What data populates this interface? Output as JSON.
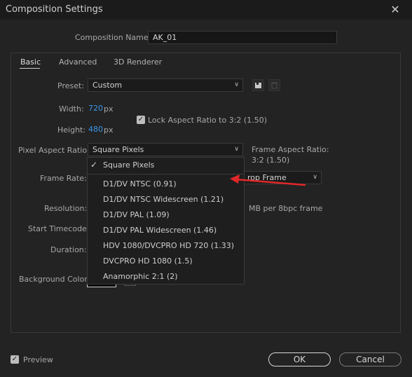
{
  "window": {
    "title": "Composition Settings",
    "close_glyph": "✕"
  },
  "comp_name": {
    "label": "Composition Name:",
    "value": "AK_01"
  },
  "tabs": [
    {
      "label": "Basic",
      "active": true
    },
    {
      "label": "Advanced",
      "active": false
    },
    {
      "label": "3D Renderer",
      "active": false
    }
  ],
  "preset": {
    "label": "Preset:",
    "value": "Custom"
  },
  "width": {
    "label": "Width:",
    "value": "720",
    "unit": "px"
  },
  "height": {
    "label": "Height:",
    "value": "480",
    "unit": "px"
  },
  "lock_aspect": {
    "label": "Lock Aspect Ratio to 3:2 (1.50)",
    "checked": true
  },
  "pixel_aspect": {
    "label": "Pixel Aspect Ratio:",
    "value": "Square Pixels"
  },
  "frame_aspect": {
    "label": "Frame Aspect Ratio:",
    "value": "3:2 (1.50)"
  },
  "frame_rate": {
    "label": "Frame Rate:",
    "drop_frame_fragment": "rop Frame"
  },
  "resolution": {
    "label": "Resolution:",
    "info_fragment": "MB per 8bpc frame"
  },
  "start_timecode": {
    "label": "Start Timecode:"
  },
  "duration": {
    "label": "Duration:"
  },
  "background_color": {
    "label": "Background Color:"
  },
  "dropdown": {
    "selected": "Square Pixels",
    "options": [
      "D1/DV NTSC (0.91)",
      "D1/DV NTSC Widescreen (1.21)",
      "D1/DV PAL (1.09)",
      "D1/DV PAL Widescreen (1.46)",
      "HDV 1080/DVCPRO HD 720 (1.33)",
      "DVCPRO HD 1080 (1.5)",
      "Anamorphic 2:1 (2)"
    ]
  },
  "preview": {
    "label": "Preview",
    "checked": true
  },
  "buttons": {
    "ok": "OK",
    "cancel": "Cancel"
  },
  "colors": {
    "accent_blue": "#3a94e6",
    "annotation_red": "#e0282a",
    "background": "#232323"
  }
}
